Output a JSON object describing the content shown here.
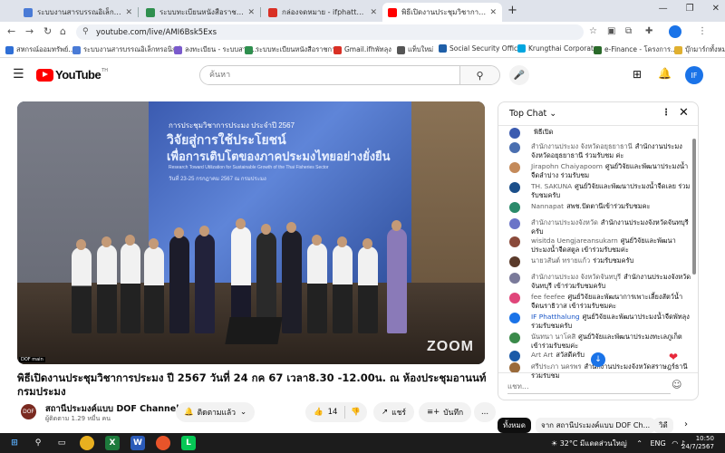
{
  "browser": {
    "tabs": [
      {
        "title": "ระบบงานสารบรรณอิเล็กทรอนิกส์",
        "color": "#4a7bd6"
      },
      {
        "title": "ระบบทะเบียนหนังสือราชการสำนักงาน",
        "color": "#2f8f4e"
      },
      {
        "title": "กล่องจดหมาย - ifphatthalung@gmail.com",
        "color": "#d93025"
      },
      {
        "title": "พิธีเปิดงานประชุมวิชาการประมง",
        "color": "#ff0000"
      }
    ],
    "url": "youtube.com/live/AMI6Bsk5Exs",
    "bookmarks": [
      {
        "label": "สหกรณ์ออมทรัพย์...",
        "color": "#2f6fd6"
      },
      {
        "label": "ระบบงานสารบรรณอิเล็กทรอนิกส์",
        "color": "#4a7bd6"
      },
      {
        "label": "ลงทะเบียน - ระบบสาร...",
        "color": "#7a5acc"
      },
      {
        "label": "ระบบทะเบียนหนังสือราชการ",
        "color": "#2f8f4e"
      },
      {
        "label": "Gmail.ifhพัทลุง",
        "color": "#d93025"
      },
      {
        "label": "แท็บใหม่",
        "color": "#555555"
      },
      {
        "label": "Social Security Office",
        "color": "#1f5fa8"
      },
      {
        "label": "Krungthai Corporat...",
        "color": "#00a6e0"
      },
      {
        "label": "e-Finance - โครงการ...",
        "color": "#2a6a2a"
      }
    ],
    "all_bookmarks": "บุ๊กมาร์กทั้งหมด"
  },
  "youtube": {
    "logo": "YouTube",
    "country": "TH",
    "search_placeholder": "ค้นหา",
    "avatar": "IF"
  },
  "video": {
    "slide_line1": "การประชุมวิชาการประมง ประจำปี 2567",
    "slide_line2": "วิจัยสู่การใช้ประโยชน์",
    "slide_line3": "เพื่อการเติบโตของภาคประมงไทยอย่างยั่งยืน",
    "slide_line4": "Research Toward Utilization for Sustainable Growth of the Thai Fisheries Sector",
    "slide_line5": "วันที่ 23-25 กรกฎาคม 2567 ณ กรมประมง",
    "watermark": "ZOOM",
    "corner_tag": "DOF main",
    "title": "พิธีเปิดงานประชุมวิชาการประมง ปี 2567 วันที่ 24 กค 67 เวลา8.30 -12.00น. ณ ห้องประชุมอานนท์ กรมประมง",
    "channel": "สถานีประมงค์แบบ DOF Channel...",
    "channel_icon": "DOF",
    "subscribers": "ผู้ติดตาม 1.29 หมื่น คน",
    "subscribed_label": "ติดตามแล้ว",
    "likes": "14",
    "share_label": "แชร์",
    "save_label": "บันทึก",
    "more_label": "..."
  },
  "chat": {
    "title": "Top Chat",
    "messages": [
      {
        "author": "",
        "text": "พิธีเปิด",
        "color": "#3b5bb0",
        "owner": false
      },
      {
        "author": "สำนักงานประมง จังหวัดอยุธยาธานี",
        "text": "สำนักงานประมงจังหวัดอยุธยาธานี ร่วมรับชม ค่ะ",
        "color": "#4a6fb0",
        "owner": false
      },
      {
        "author": "Jirapohn Chaiyapoom",
        "text": "ศูนย์วิจัยและพัฒนาประมงน้ำจืดลำปาง ร่วมรับชม",
        "color": "#c48a5a",
        "owner": false
      },
      {
        "author": "TH. SAKUNA",
        "text": "ศูนย์วิจัยและพัฒนาประมงน้ำจืดเลย ร่วมรับชมครับ",
        "color": "#1b4f8a",
        "owner": false
      },
      {
        "author": "Nannapat",
        "text": "สพช.ปัตตานีเข้าร่วมรับชมคะ",
        "color": "#2a8a6a",
        "owner": false
      },
      {
        "author": "สำนักงานประมงจังหวัด",
        "text": "สำนักงานประมงจังหวัดจันทบุรีครับ",
        "color": "#6b74c8",
        "owner": false
      },
      {
        "author": "wisitda Uengjareansukarn",
        "text": "ศูนย์วิจัยและพัฒนาประมงน้ำจืดสตูล เข้าร่วมรับชมค่ะ",
        "color": "#8a4a3a",
        "owner": false
      },
      {
        "author": "นายวสันต์ ทรายแก้ว",
        "text": "ร่วมรับชมครับ",
        "color": "#5a3a2a",
        "owner": false
      },
      {
        "author": "สำนักงานประมง จังหวัดจันทบุรี",
        "text": "สำนักงานประมงจังหวัดจันทบุรี เข้าร่วมรับชมครับ",
        "color": "#7a7a9a",
        "owner": false
      },
      {
        "author": "fee feefee",
        "text": "ศูนย์วิจัยและพัฒนาการเพาะเลี้ยงสัตว์น้ำจืดนราธิวาส เข้าร่วมรับชมคะ",
        "color": "#e0457a",
        "owner": false
      },
      {
        "author": "IF Phatthalung",
        "text": "ศูนย์วิจัยและพัฒนาประมงน้ำจืดพัทลุง ร่วมรับชมครับ",
        "color": "#1a73e8",
        "owner": true
      },
      {
        "author": "นันทนา นาโคสิ",
        "text": "ศูนย์วิจัยและพัฒนาประมงทะเลภูเก็ต เข้าร่วมรับชมค่ะ",
        "color": "#3a8a4a",
        "owner": false
      },
      {
        "author": "Art Art",
        "text": "สวัสดีครับ",
        "color": "#1a5aa8",
        "owner": false
      },
      {
        "author": "ศรีประภา นครพร",
        "text": "สำนักงานประมงจังหวัดสราษฎร์ธานี ร่วมรับชม",
        "color": "#9a6a3a",
        "owner": false
      }
    ],
    "input_placeholder": "แชท...",
    "heart": "❤",
    "scroll_down": "↓"
  },
  "chips": [
    {
      "label": "ทั้งหมด",
      "active": true
    },
    {
      "label": "จาก สถานีประมงค์แบบ DOF Ch...",
      "active": false
    },
    {
      "label": "วิดี",
      "active": false
    }
  ],
  "taskbar": {
    "weather": "32°C",
    "weather_text": "มีแดดส่วนใหญ่",
    "language": "ENG",
    "time": "10:50",
    "date": "24/7/2567"
  }
}
